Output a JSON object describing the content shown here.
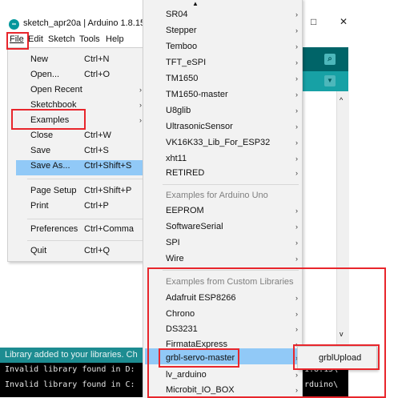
{
  "window": {
    "title": "sketch_apr20a | Arduino 1.8.15",
    "minimize": "–",
    "maximize": "□",
    "close": "✕",
    "logo_icon": "arduino-logo-icon"
  },
  "menubar": {
    "file": "File",
    "edit": "Edit",
    "sketch": "Sketch",
    "tools": "Tools",
    "help": "Help"
  },
  "toolbar": {
    "serial_monitor_icon": "magnifier-icon",
    "tab_menu_icon": "dropdown-triangle-icon"
  },
  "file_menu": {
    "items": [
      {
        "label": "New",
        "shortcut": "Ctrl+N"
      },
      {
        "label": "Open...",
        "shortcut": "Ctrl+O"
      },
      {
        "label": "Open Recent",
        "shortcut": ""
      },
      {
        "label": "Sketchbook",
        "shortcut": ""
      },
      {
        "label": "Examples",
        "shortcut": ""
      },
      {
        "label": "Close",
        "shortcut": "Ctrl+W"
      },
      {
        "label": "Save",
        "shortcut": "Ctrl+S"
      },
      {
        "label": "Save As...",
        "shortcut": "Ctrl+Shift+S"
      },
      {
        "label": "Page Setup",
        "shortcut": "Ctrl+Shift+P"
      },
      {
        "label": "Print",
        "shortcut": "Ctrl+P"
      },
      {
        "label": "Preferences",
        "shortcut": "Ctrl+Comma"
      },
      {
        "label": "Quit",
        "shortcut": "Ctrl+Q"
      }
    ],
    "highlighted": "Examples"
  },
  "examples_menu": {
    "scroll_up_icon": "triangle-up-icon",
    "libraries": [
      "SR04",
      "Stepper",
      "Temboo",
      "TFT_eSPI",
      "TM1650",
      "TM1650-master",
      "U8glib",
      "UltrasonicSensor",
      "VK16K33_Lib_For_ESP32",
      "xht11",
      "RETIRED"
    ],
    "uno_header": "Examples for Arduino Uno",
    "uno_examples": [
      "EEPROM",
      "SoftwareSerial",
      "SPI",
      "Wire"
    ],
    "custom_header": "Examples from Custom Libraries",
    "custom_examples": [
      "Adafruit ESP8266",
      "Chrono",
      "DS3231",
      "FirmataExpress",
      "grbl-servo-master",
      "lv_arduino",
      "Microbit_IO_BOX"
    ],
    "highlighted": "grbl-servo-master"
  },
  "submenu": {
    "item": "grblUpload"
  },
  "status": {
    "message": "Library added to your libraries. Ch"
  },
  "console": {
    "lines": [
      "Invalid library found in D:",
      "Invalid library found in C:"
    ],
    "right_lines": [
      "1.8.15\\",
      "rduino\\"
    ]
  },
  "colors": {
    "highlight": "#91c9f7",
    "annotation_red": "#e8262c",
    "arduino_teal": "#006468",
    "status_teal": "#1d8c91"
  }
}
